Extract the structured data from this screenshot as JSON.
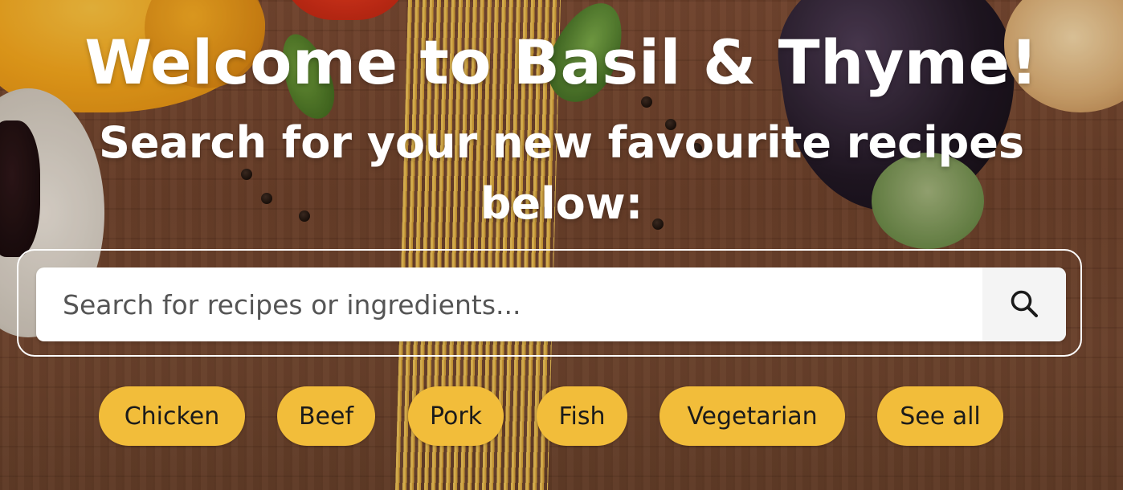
{
  "hero": {
    "title": "Welcome to Basil & Thyme!",
    "subtitle": "Search for your new favourite recipes below:"
  },
  "search": {
    "placeholder": "Search for recipes or ingredients...",
    "button_icon": "search-icon"
  },
  "categories": [
    {
      "label": "Chicken"
    },
    {
      "label": "Beef"
    },
    {
      "label": "Pork"
    },
    {
      "label": "Fish"
    },
    {
      "label": "Vegetarian"
    },
    {
      "label": "See all"
    }
  ],
  "colors": {
    "chip_background": "#f2bd3a",
    "heading_text": "#ffffff",
    "search_background": "#ffffff"
  }
}
